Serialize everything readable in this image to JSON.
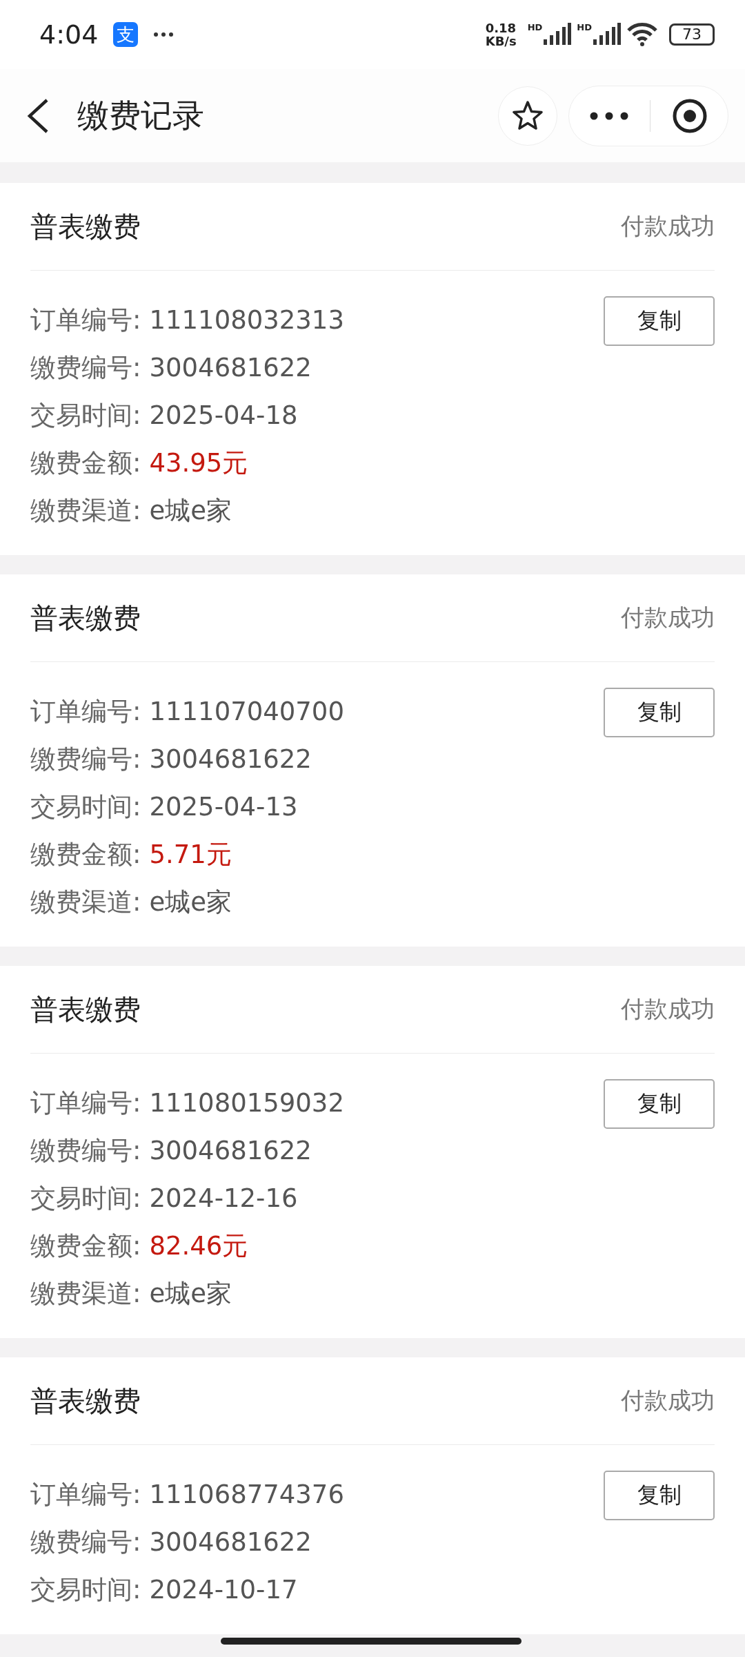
{
  "status_bar": {
    "time": "4:04",
    "app_badge": "支",
    "speed": [
      "0.18",
      "KB/s"
    ],
    "sim_labels": [
      "HD",
      "HD"
    ],
    "battery": "73"
  },
  "header": {
    "title": "缴费记录"
  },
  "records": [
    {
      "title": "普表缴费",
      "status": "付款成功",
      "copy_label": "复制",
      "fields": [
        {
          "label": "订单编号:",
          "value": "111108032313",
          "kind": "text"
        },
        {
          "label": "缴费编号:",
          "value": "3004681622",
          "kind": "text"
        },
        {
          "label": "交易时间:",
          "value": "2025-04-18",
          "kind": "text"
        },
        {
          "label": "缴费金额:",
          "value": "43.95元",
          "kind": "amount"
        },
        {
          "label": "缴费渠道:",
          "value": "e城e家",
          "kind": "text"
        }
      ]
    },
    {
      "title": "普表缴费",
      "status": "付款成功",
      "copy_label": "复制",
      "fields": [
        {
          "label": "订单编号:",
          "value": "111107040700",
          "kind": "text"
        },
        {
          "label": "缴费编号:",
          "value": "3004681622",
          "kind": "text"
        },
        {
          "label": "交易时间:",
          "value": "2025-04-13",
          "kind": "text"
        },
        {
          "label": "缴费金额:",
          "value": "5.71元",
          "kind": "amount"
        },
        {
          "label": "缴费渠道:",
          "value": "e城e家",
          "kind": "text"
        }
      ]
    },
    {
      "title": "普表缴费",
      "status": "付款成功",
      "copy_label": "复制",
      "fields": [
        {
          "label": "订单编号:",
          "value": "111080159032",
          "kind": "text"
        },
        {
          "label": "缴费编号:",
          "value": "3004681622",
          "kind": "text"
        },
        {
          "label": "交易时间:",
          "value": "2024-12-16",
          "kind": "text"
        },
        {
          "label": "缴费金额:",
          "value": "82.46元",
          "kind": "amount"
        },
        {
          "label": "缴费渠道:",
          "value": "e城e家",
          "kind": "text"
        }
      ]
    },
    {
      "title": "普表缴费",
      "status": "付款成功",
      "copy_label": "复制",
      "fields": [
        {
          "label": "订单编号:",
          "value": "111068774376",
          "kind": "text"
        },
        {
          "label": "缴费编号:",
          "value": "3004681622",
          "kind": "text"
        },
        {
          "label": "交易时间:",
          "value": "2024-10-17",
          "kind": "text"
        }
      ]
    }
  ]
}
